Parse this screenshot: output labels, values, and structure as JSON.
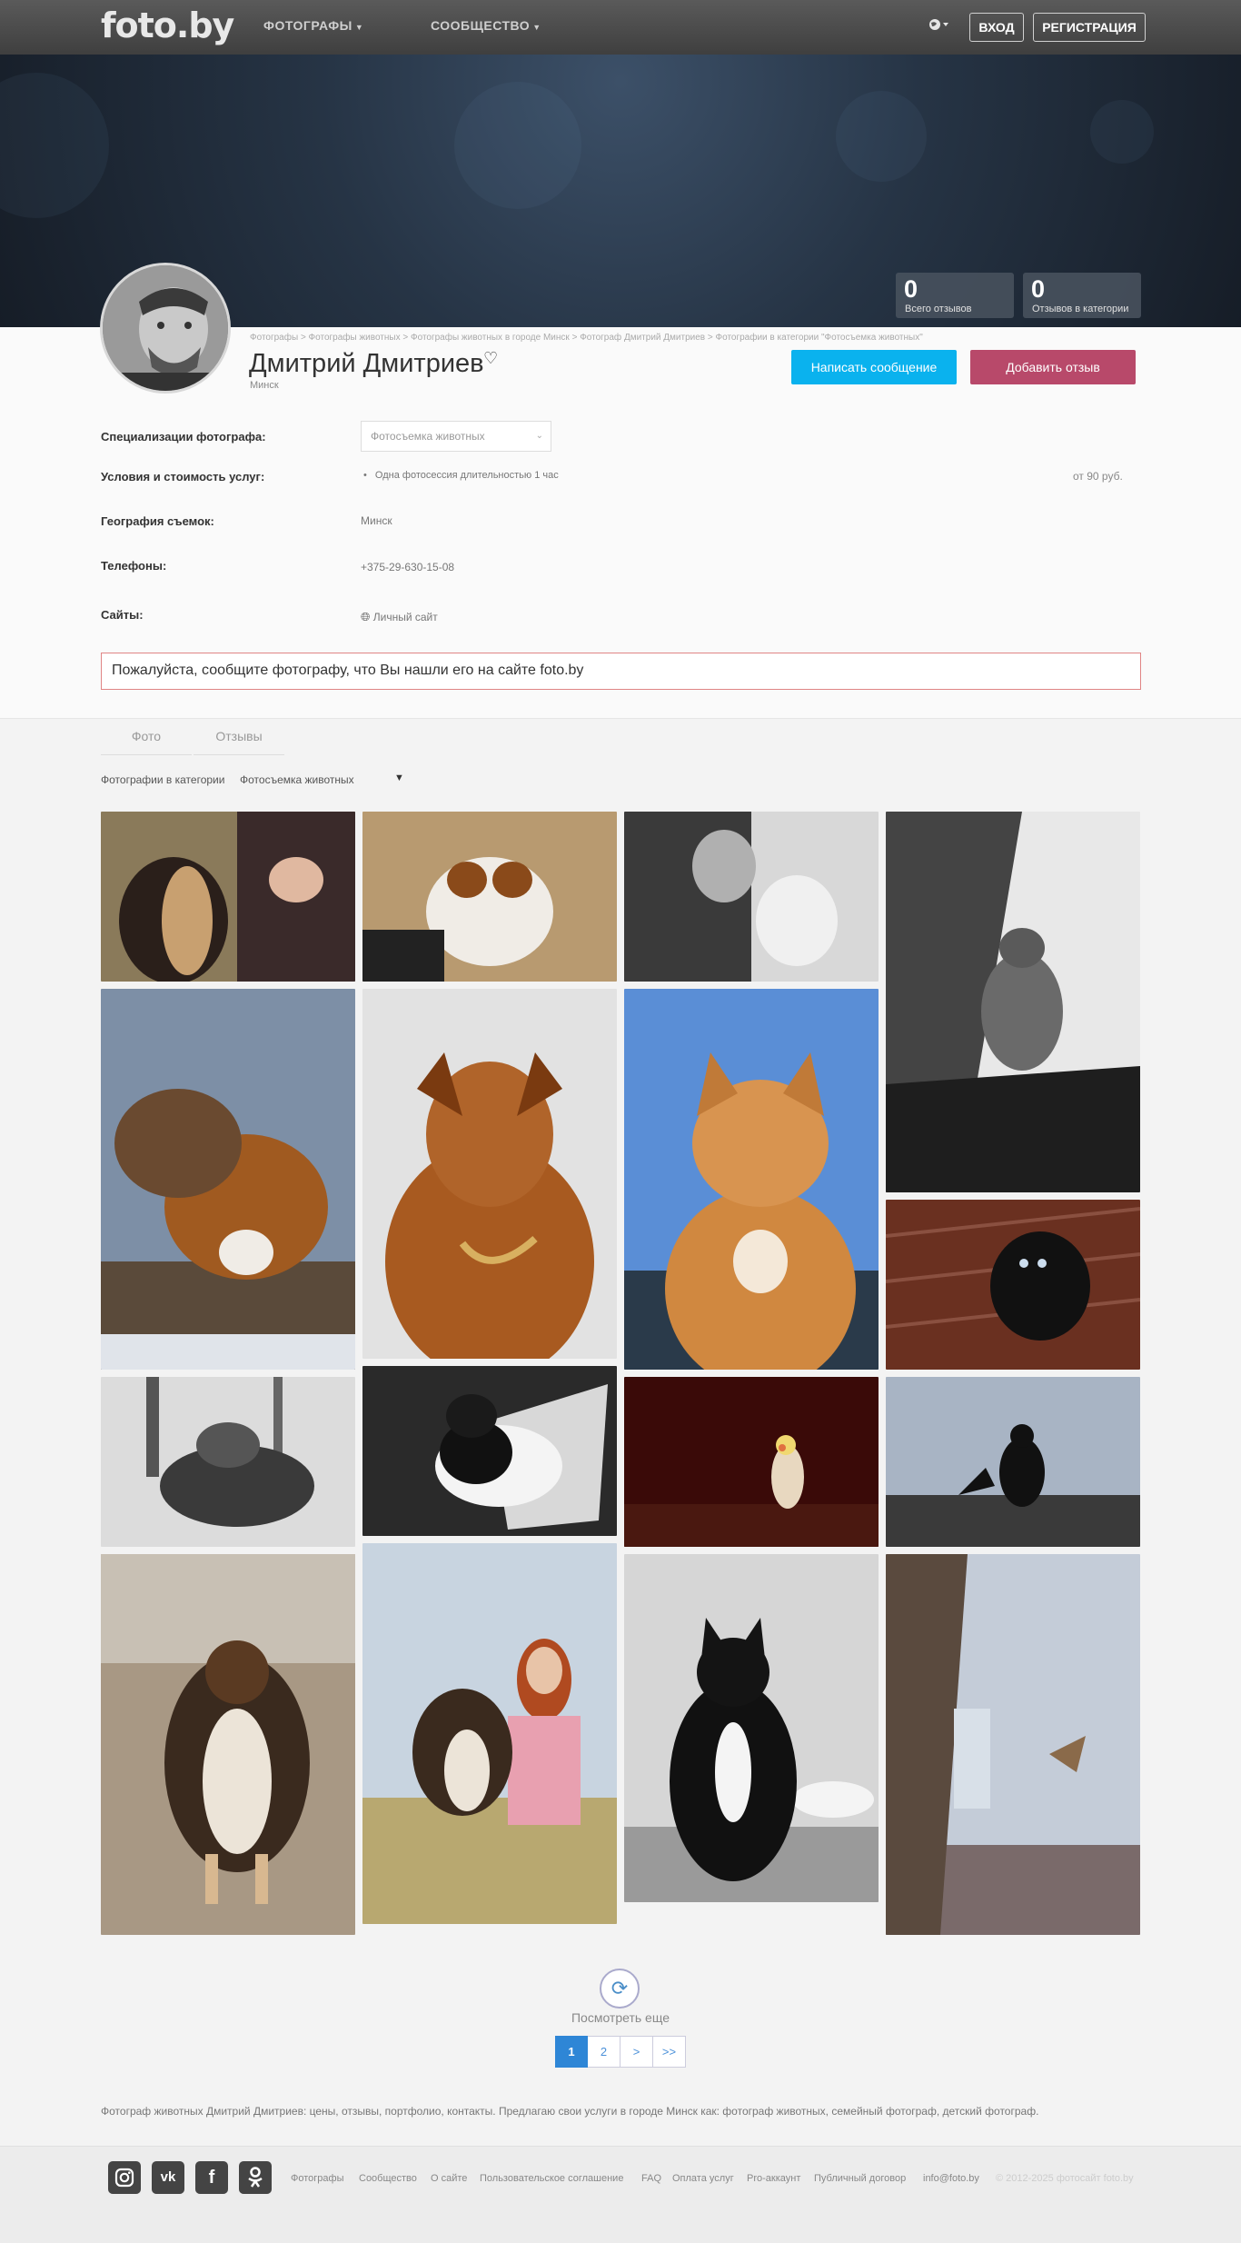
{
  "header": {
    "logo": "foto.by",
    "nav": [
      {
        "label": "ФОТОГРАФЫ"
      },
      {
        "label": "СООБЩЕСТВО"
      }
    ],
    "login": "ВХОД",
    "register": "РЕГИСТРАЦИЯ"
  },
  "stats": [
    {
      "value": "0",
      "label": "Всего отзывов"
    },
    {
      "value": "0",
      "label": "Отзывов в категории"
    }
  ],
  "profile": {
    "breadcrumb": "Фотографы > Фотографы животных > Фотографы животных в городе Минск > Фотограф Дмитрий Дмитриев > Фотографии в категории \"Фотосъемка животных\"",
    "name": "Дмитрий Дмитриев",
    "city": "Минск",
    "message_button": "Написать сообщение",
    "review_button": "Добавить отзыв"
  },
  "info": {
    "spec_label": "Специализации фотографа:",
    "spec_value": "Фотосъемка животных",
    "terms_label": "Условия и стоимость услуг:",
    "terms_item": "Одна фотосессия длительностью 1 час",
    "terms_price": "от 90 руб.",
    "geo_label": "География съемок:",
    "geo_value": "Минск",
    "phone_label": "Телефоны:",
    "phone_value": "+375-29-630-15-08",
    "sites_label": "Сайты:",
    "sites_value": "Личный сайт"
  },
  "notice": "Пожалуйста, сообщите фотографу, что Вы нашли его на сайте foto.by",
  "tabs": [
    {
      "label": "Фото"
    },
    {
      "label": "Отзывы"
    }
  ],
  "filter": {
    "label": "Фотографии в категории",
    "value": "Фотосъемка животных"
  },
  "load_more": "Посмотреть еще",
  "pager": [
    "1",
    "2",
    ">",
    ">>"
  ],
  "seo_text": "Фотограф животных Дмитрий Дмитриев: цены, отзывы, портфолио, контакты. Предлагаю свои услуги в городе Минск как: фотограф животных, семейный фотограф, детский фотограф.",
  "footer": {
    "social": [
      "instagram-icon",
      "vk-icon",
      "facebook-icon",
      "odnoklassniki-icon"
    ],
    "links": [
      "Фотографы",
      "Сообщество",
      "О сайте",
      "Пользовательское соглашение",
      "FAQ",
      "Оплата услуг",
      "Pro-аккаунт",
      "Публичный договор",
      "info@foto.by"
    ],
    "copyright": "© 2012-2025 фотосайт foto.by"
  }
}
